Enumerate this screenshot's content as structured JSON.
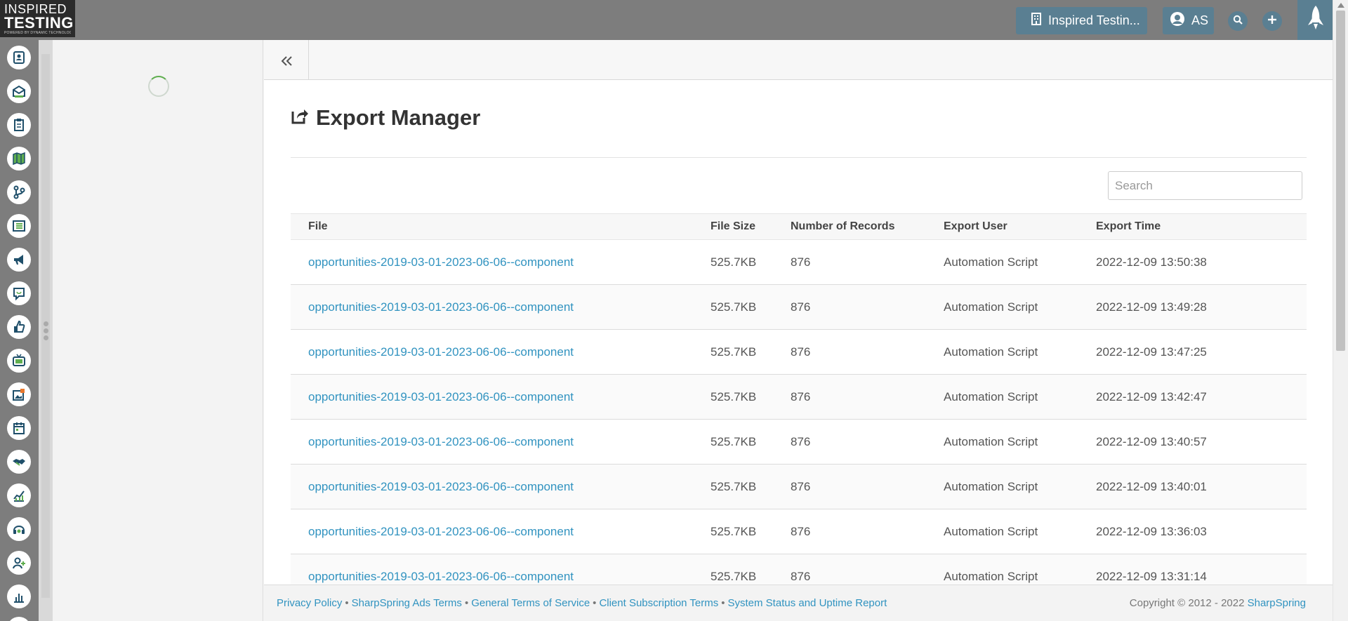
{
  "brand": {
    "line1": "INSPIRED",
    "line2": "TESTING",
    "line3": "POWERED BY DYNAMIC TECHNOLOGIES"
  },
  "topbar": {
    "company": "Inspired Testin...",
    "user_initials": "AS"
  },
  "rail_icons": [
    "contacts-icon",
    "email-icon",
    "forms-icon",
    "map-icon",
    "workflow-icon",
    "list-icon",
    "megaphone-icon",
    "chat-icon",
    "like-icon",
    "media-icon",
    "images-icon",
    "calendar-icon",
    "handshake-icon",
    "analytics-icon",
    "support-icon",
    "add-user-icon",
    "reports-icon"
  ],
  "page": {
    "title": "Export Manager"
  },
  "search": {
    "placeholder": "Search"
  },
  "table": {
    "headers": [
      "File",
      "File Size",
      "Number of Records",
      "Export User",
      "Export Time"
    ],
    "rows": [
      {
        "file": "opportunities-2019-03-01-2023-06-06--component",
        "size": "525.7KB",
        "records": "876",
        "user": "Automation Script",
        "time": "2022-12-09 13:50:38"
      },
      {
        "file": "opportunities-2019-03-01-2023-06-06--component",
        "size": "525.7KB",
        "records": "876",
        "user": "Automation Script",
        "time": "2022-12-09 13:49:28"
      },
      {
        "file": "opportunities-2019-03-01-2023-06-06--component",
        "size": "525.7KB",
        "records": "876",
        "user": "Automation Script",
        "time": "2022-12-09 13:47:25"
      },
      {
        "file": "opportunities-2019-03-01-2023-06-06--component",
        "size": "525.7KB",
        "records": "876",
        "user": "Automation Script",
        "time": "2022-12-09 13:42:47"
      },
      {
        "file": "opportunities-2019-03-01-2023-06-06--component",
        "size": "525.7KB",
        "records": "876",
        "user": "Automation Script",
        "time": "2022-12-09 13:40:57"
      },
      {
        "file": "opportunities-2019-03-01-2023-06-06--component",
        "size": "525.7KB",
        "records": "876",
        "user": "Automation Script",
        "time": "2022-12-09 13:40:01"
      },
      {
        "file": "opportunities-2019-03-01-2023-06-06--component",
        "size": "525.7KB",
        "records": "876",
        "user": "Automation Script",
        "time": "2022-12-09 13:36:03"
      },
      {
        "file": "opportunities-2019-03-01-2023-06-06--component",
        "size": "525.7KB",
        "records": "876",
        "user": "Automation Script",
        "time": "2022-12-09 13:31:14"
      }
    ]
  },
  "footer": {
    "links": [
      "Privacy Policy",
      "SharpSpring Ads Terms",
      "General Terms of Service",
      "Client Subscription Terms",
      "System Status and Uptime Report"
    ],
    "separator": "•",
    "copyright": "Copyright © 2012 - 2022",
    "brand_link": "SharpSpring"
  },
  "colors": {
    "topbar": "#7d7d7d",
    "button": "#5a7f92",
    "link": "#3193c0",
    "spinner": "#5fae4f"
  }
}
